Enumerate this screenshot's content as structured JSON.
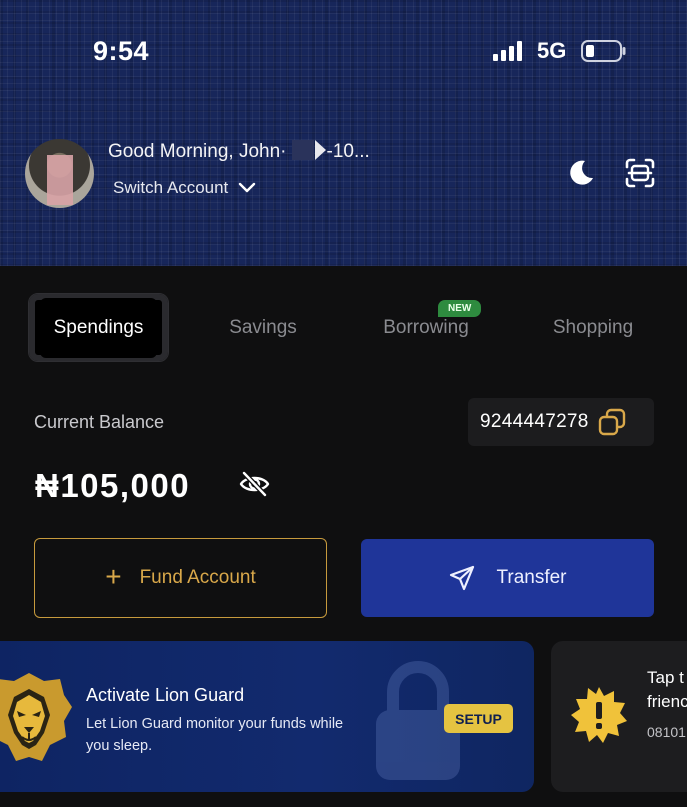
{
  "status_bar": {
    "time": "9:54",
    "network": "5G"
  },
  "header": {
    "greeting_prefix": "Good Morning,  John·",
    "greeting_suffix": "-10...",
    "switch_account": "Switch Account"
  },
  "tabs": [
    {
      "label": "Spendings",
      "active": true
    },
    {
      "label": "Savings",
      "active": false
    },
    {
      "label": "Borrowing",
      "active": false,
      "badge": "NEW"
    },
    {
      "label": "Shopping",
      "active": false
    }
  ],
  "balance": {
    "label": "Current Balance",
    "account_number": "9244447278",
    "amount": "₦105,000"
  },
  "actions": {
    "fund_label": "Fund Account",
    "fund_plus": "+",
    "transfer_label": "Transfer"
  },
  "banners": {
    "lion_guard": {
      "title": "Activate Lion Guard",
      "description": "Let Lion Guard monitor your funds while you sleep.",
      "button": "SETUP"
    },
    "tap_card": {
      "title_line1": "Tap t",
      "title_line2": "frienc",
      "subtitle": "08101"
    }
  },
  "colors": {
    "header_bg": "#17265a",
    "accent_gold": "#d9a84a",
    "transfer_blue": "#1f3599",
    "badge_green": "#2e8b3f",
    "setup_yellow": "#e5c341"
  }
}
